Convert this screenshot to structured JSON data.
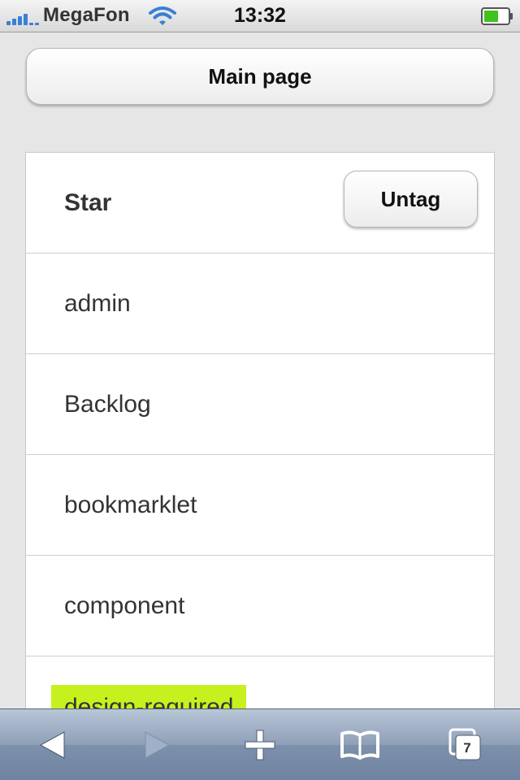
{
  "status_bar": {
    "carrier": "MegaFon",
    "time": "13:32"
  },
  "main_button": {
    "label": "Main page"
  },
  "header_row": {
    "title": "Star",
    "untag_label": "Untag"
  },
  "tags": [
    {
      "label": "admin"
    },
    {
      "label": "Backlog"
    },
    {
      "label": "bookmarklet"
    },
    {
      "label": "component"
    },
    {
      "label": "design-required",
      "highlight_color": "#c6f11e"
    }
  ],
  "toolbar": {
    "icons": [
      "back-icon",
      "forward-icon",
      "add-icon",
      "bookmarks-icon",
      "tabs-icon"
    ],
    "tabs_count": "7"
  },
  "colors": {
    "accent_highlight": "#c6f11e",
    "toolbar": "#8e9fb7",
    "signal": "#3a7fd6"
  }
}
